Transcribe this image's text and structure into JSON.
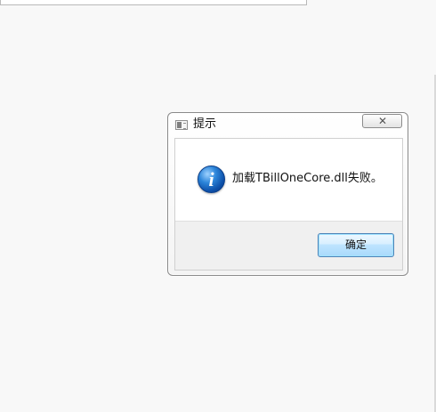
{
  "dialog": {
    "title": "提示",
    "message": "加载TBillOneCore.dll失败。",
    "ok_label": "确定",
    "title_icon": "window-app-icon",
    "message_icon": "information-icon",
    "close_icon": "close-icon"
  },
  "colors": {
    "desktop_background": "#f8f8f8",
    "dialog_border": "#8a8a8a",
    "button_area": "#f0f0f0",
    "button_border": "#4f84b7",
    "info_icon": "#2d86da",
    "text": "#111111"
  }
}
